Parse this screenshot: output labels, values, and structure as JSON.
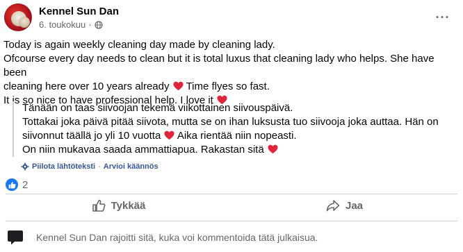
{
  "post": {
    "author": "Kennel Sun Dan",
    "date": "6. toukokuu",
    "date_separator": "·",
    "more_label": "···",
    "text_lines": [
      "Today is again weekly cleaning day made by cleaning lady.",
      "Ofcourse every day needs to clean but it is total luxus that cleaning lady who helps. She have been",
      "cleaning here over 10 years already",
      "Time flyes so fast.",
      "It is so nice to have professional help. I love it"
    ],
    "translation_lines": [
      "Tänään on taas siivoojan tekemä viikottainen siivouspäivä.",
      "Tottakai joka päivä pitää siivota, mutta se on ihan luksusta tuo siivooja joka auttaa. Hän on",
      "siivonnut täällä jo yli 10 vuotta",
      "Aika rientää niin nopeasti.",
      "On niin mukavaa saada ammattiapua. Rakastan sitä"
    ],
    "hide_original": "Piilota lähtöteksti",
    "translate_sep": "·",
    "rate_translation": "Arvioi käännös",
    "reaction_count": "2",
    "like_label": "Tykkää",
    "share_label": "Jaa",
    "restricted_text": "Kennel Sun Dan rajoitti sitä, kuka voi kommentoida tätä julkaisua."
  },
  "colors": {
    "accent": "#1877f2",
    "link": "#385898",
    "heart": "#e0243a",
    "muted": "#65676b"
  },
  "icons": {
    "avatar": "profile-photo",
    "globe": "globe-icon",
    "gear": "gear-icon",
    "like": "thumbs-up-icon",
    "share": "share-arrow-icon",
    "heart": "red-heart-icon",
    "comment_lock": "comment-restricted-icon"
  }
}
